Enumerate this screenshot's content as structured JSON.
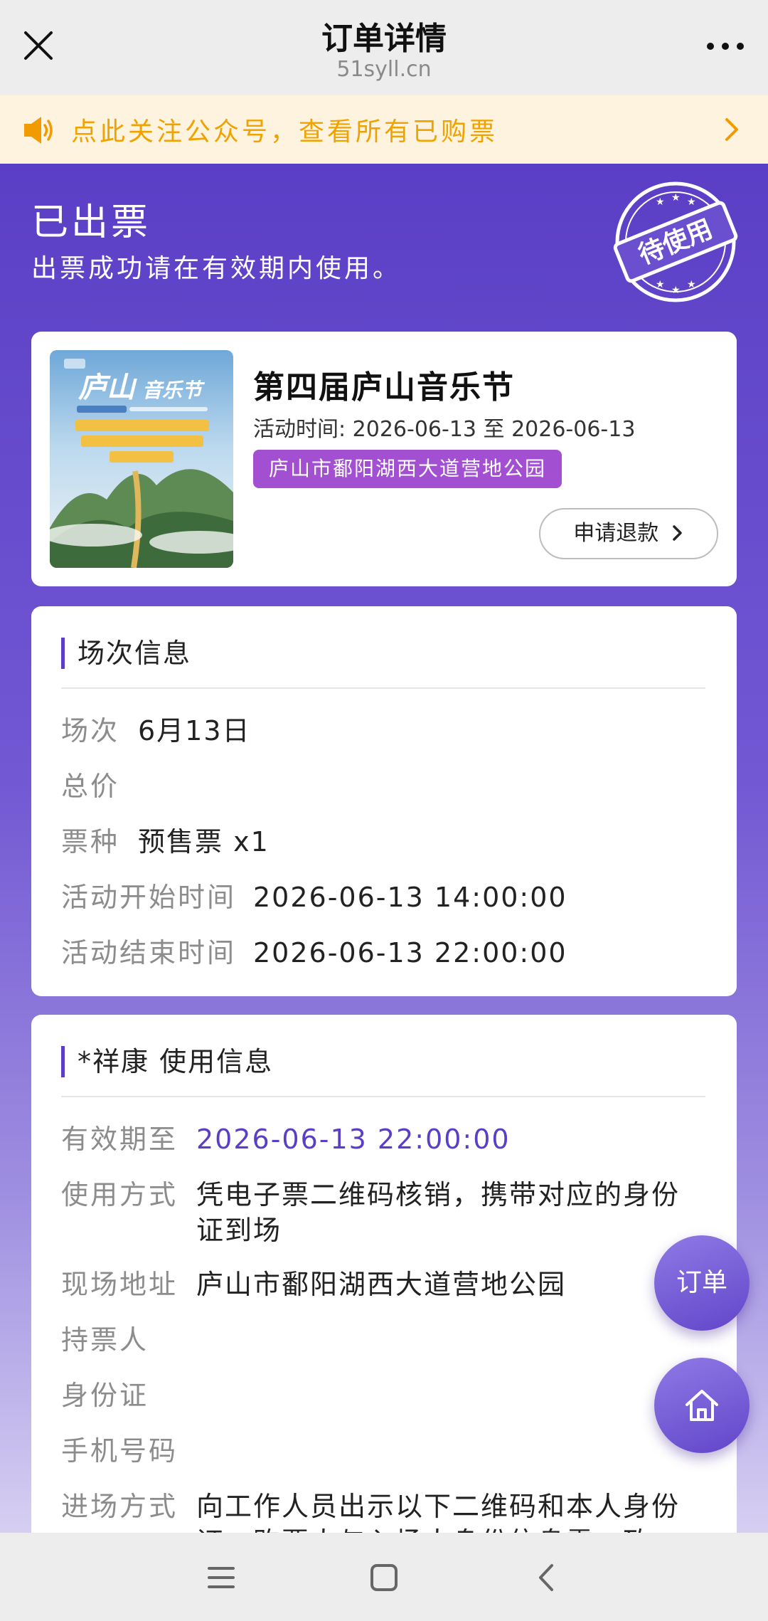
{
  "header": {
    "title": "订单详情",
    "domain": "51syll.cn"
  },
  "notice": {
    "text": "点此关注公众号，查看所有已购票"
  },
  "status": {
    "title": "已出票",
    "subtitle": "出票成功请在有效期内使用。",
    "stamp": "待使用"
  },
  "event": {
    "name": "第四届庐山音乐节",
    "time_label": "活动时间: ",
    "time_value": "2026-06-13 至 2026-06-13",
    "venue": "庐山市鄱阳湖西大道营地公园",
    "refund_label": "申请退款"
  },
  "session": {
    "heading": "场次信息",
    "rows": [
      {
        "label": "场次",
        "value": "6月13日"
      },
      {
        "label": "总价",
        "value": ""
      },
      {
        "label": "票种",
        "value": "预售票 x1"
      },
      {
        "label": "活动开始时间",
        "value": "2026-06-13 14:00:00"
      },
      {
        "label": "活动结束时间",
        "value": "2026-06-13 22:00:00"
      }
    ]
  },
  "usage": {
    "heading": "*祥康 使用信息",
    "rows": [
      {
        "label": "有效期至",
        "value": "2026-06-13 22:00:00"
      },
      {
        "label": "使用方式",
        "value": "凭电子票二维码核销，携带对应的身份证到场"
      },
      {
        "label": "现场地址",
        "value": "庐山市鄱阳湖西大道营地公园"
      },
      {
        "label": "持票人",
        "value": ""
      },
      {
        "label": "身份证",
        "value": ""
      },
      {
        "label": "手机号码",
        "value": ""
      },
      {
        "label": "进场方式",
        "value": "向工作人员出示以下二维码和本人身份证，购票人与入场人身份信息需一致"
      }
    ]
  },
  "floating": {
    "orders_label": "订单"
  },
  "colors": {
    "accent": "#5a3fc6",
    "notice_text": "#f0a300",
    "venue_tag": "#a24fd1"
  }
}
